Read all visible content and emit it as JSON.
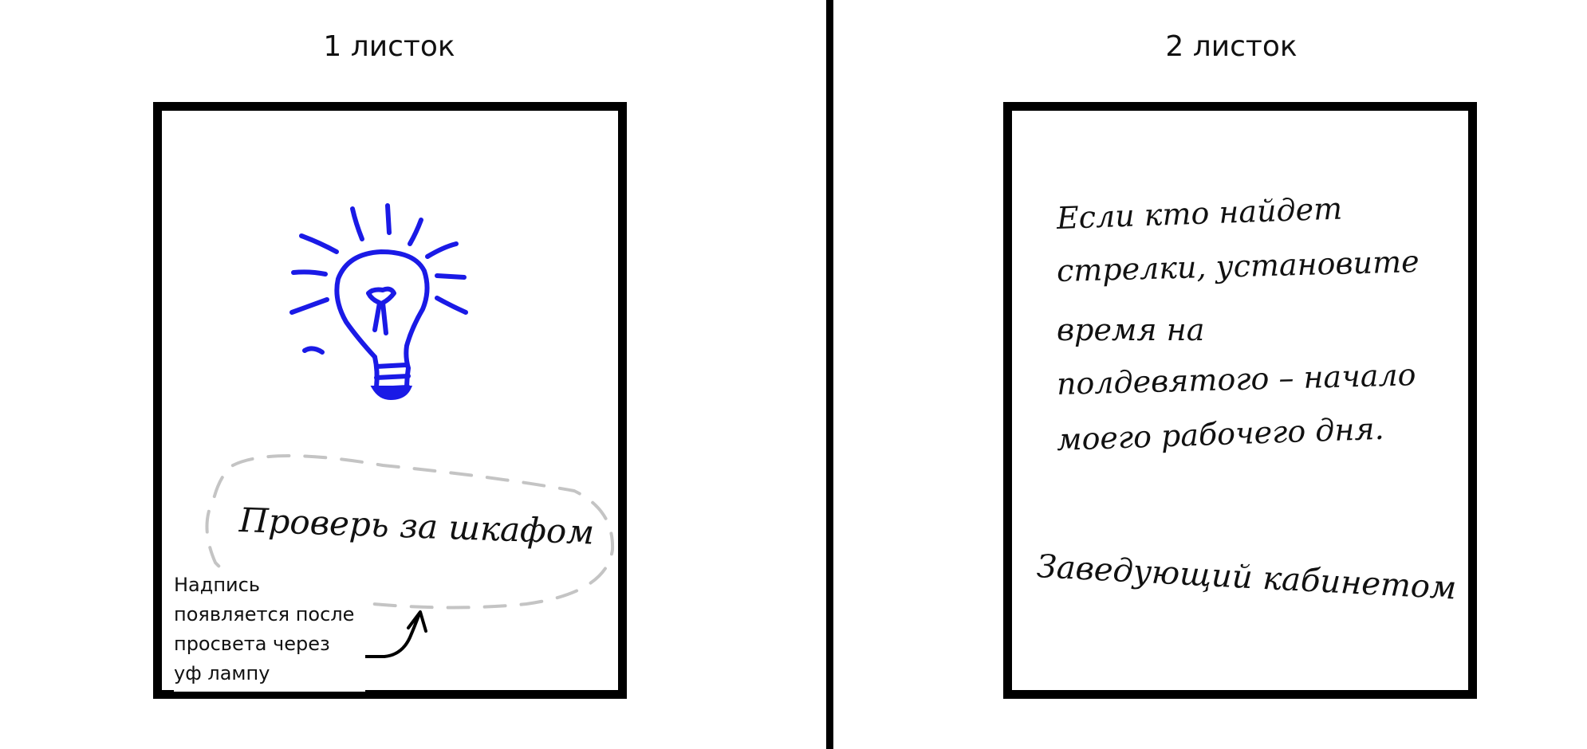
{
  "sheets": [
    {
      "title": "1 листок"
    },
    {
      "title": "2 листок"
    }
  ],
  "sheet1": {
    "uv_text": "Проверь за шкафом",
    "note_lines": [
      "Надпись",
      "появляется после",
      "просвета через",
      "уф лампу"
    ],
    "icon": "lightbulb-icon",
    "icon_color": "#1a1ae6",
    "dashed_color": "#c4c4c4"
  },
  "sheet2": {
    "message_lines": [
      "Если кто найдет",
      "стрелки, установите",
      "время на",
      "полдевятого – начало",
      "моего рабочего дня."
    ],
    "signature": "Заведующий кабинетом"
  }
}
